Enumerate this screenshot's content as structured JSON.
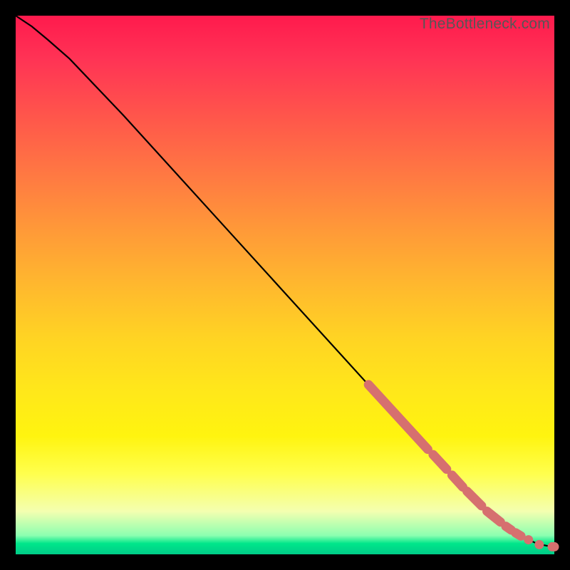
{
  "watermark": "TheBottleneck.com",
  "chart_data": {
    "type": "line",
    "title": "",
    "xlabel": "",
    "ylabel": "",
    "xlim": [
      0,
      100
    ],
    "ylim": [
      0,
      100
    ],
    "grid": false,
    "series": [
      {
        "name": "curve",
        "x": [
          0,
          3,
          6,
          10,
          20,
          30,
          40,
          50,
          60,
          65,
          70,
          75,
          80,
          85,
          90,
          93,
          95,
          97,
          99.6,
          100
        ],
        "values": [
          100,
          98,
          95.5,
          92,
          81.5,
          70.5,
          59.5,
          48.5,
          37.5,
          32,
          26.5,
          21,
          15.5,
          10.5,
          6,
          4,
          2.8,
          1.9,
          1.4,
          1.4
        ]
      }
    ],
    "markers": {
      "name": "highlighted-points",
      "color": "#d6706f",
      "segments": [
        {
          "x0": 65.5,
          "y0": 31.5,
          "x1": 76.5,
          "y1": 19.5
        },
        {
          "x0": 77.5,
          "y0": 18.5,
          "x1": 80.0,
          "y1": 15.8
        },
        {
          "x0": 81.0,
          "y0": 14.7,
          "x1": 83.0,
          "y1": 12.5
        },
        {
          "x0": 83.8,
          "y0": 11.7,
          "x1": 86.5,
          "y1": 9.0
        },
        {
          "x0": 87.5,
          "y0": 8.0,
          "x1": 90.0,
          "y1": 6.0
        },
        {
          "x0": 91.0,
          "y0": 5.2,
          "x1": 92.0,
          "y1": 4.5
        },
        {
          "x0": 92.8,
          "y0": 4.0,
          "x1": 93.8,
          "y1": 3.4
        }
      ],
      "dots": [
        {
          "x": 95.2,
          "y": 2.7
        },
        {
          "x": 97.2,
          "y": 1.8
        },
        {
          "x": 99.6,
          "y": 1.4
        },
        {
          "x": 100,
          "y": 1.4
        }
      ]
    }
  }
}
